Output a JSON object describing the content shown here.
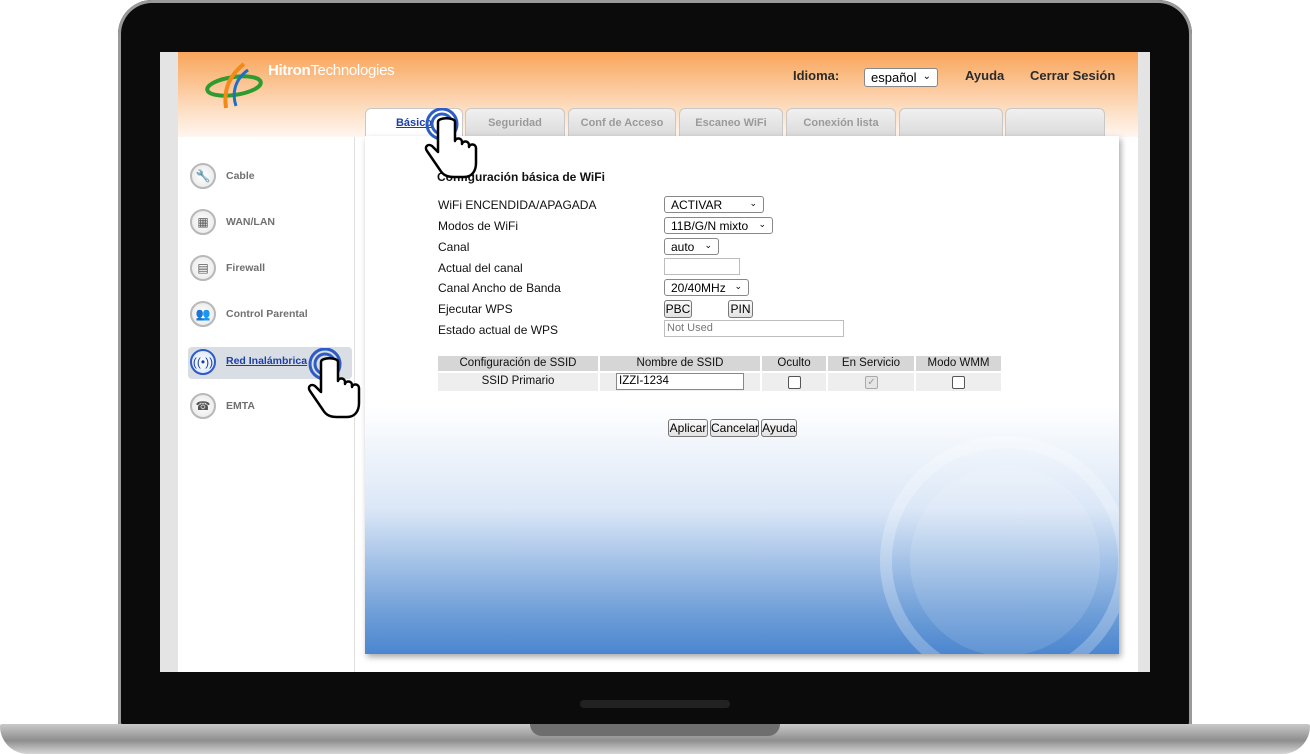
{
  "header": {
    "brand_bold": "Hitron",
    "brand_rest": "Technologies",
    "idioma_label": "Idioma:",
    "language_value": "español",
    "help_link": "Ayuda",
    "logout_link": "Cerrar Sesión"
  },
  "tabs": [
    {
      "label": "Básico"
    },
    {
      "label": "Seguridad"
    },
    {
      "label": "Conf de Acceso"
    },
    {
      "label": "Escaneo WiFi"
    },
    {
      "label": "Conexión lista"
    },
    {
      "label": ""
    },
    {
      "label": ""
    }
  ],
  "sidebar": {
    "items": [
      {
        "label": "Cable",
        "icon": "wrench-icon"
      },
      {
        "label": "WAN/LAN",
        "icon": "network-icon"
      },
      {
        "label": "Firewall",
        "icon": "firewall-icon"
      },
      {
        "label": "Control Parental",
        "icon": "parental-icon"
      },
      {
        "label": "Red Inalámbrica",
        "icon": "wireless-icon"
      },
      {
        "label": "EMTA",
        "icon": "phone-icon"
      }
    ]
  },
  "form": {
    "title": "Configuración básica de WiFi",
    "wifi_onoff_label": "WiFi ENCENDIDA/APAGADA",
    "wifi_onoff_value": "ACTIVAR",
    "wifi_mode_label": "Modos de WiFi",
    "wifi_mode_value": "11B/G/N mixto",
    "channel_label": "Canal",
    "channel_value": "auto",
    "current_channel_label": "Actual del canal",
    "current_channel_value": "",
    "bandwidth_label": "Canal Ancho de Banda",
    "bandwidth_value": "20/40MHz",
    "wps_label": "Ejecutar WPS",
    "wps_pbc": "PBC",
    "wps_pin": "PIN",
    "wps_state_label": "Estado actual de WPS",
    "wps_state_placeholder": "Not Used"
  },
  "ssid_table": {
    "headers": [
      "Configuración de SSID",
      "Nombre de SSID",
      "Oculto",
      "En Servicio",
      "Modo WMM"
    ],
    "row": {
      "config": "SSID Primario",
      "name": "IZZI-1234",
      "hidden": false,
      "in_service": true,
      "wmm": false
    }
  },
  "actions": {
    "apply": "Aplicar",
    "cancel": "Cancelar",
    "help": "Ayuda"
  },
  "colors": {
    "header_orange": "#f9a55a",
    "link_blue": "#1a3fa6",
    "content_blue": "#4b86cf"
  }
}
